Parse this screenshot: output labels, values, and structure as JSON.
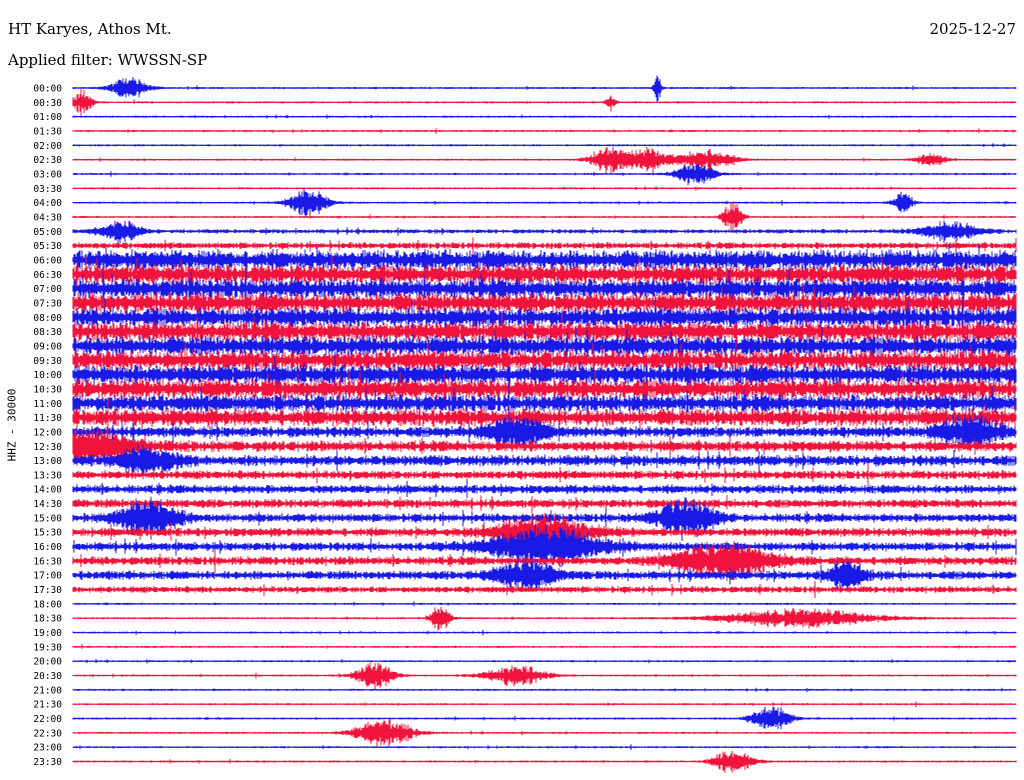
{
  "header": {
    "station": "HT Karyes, Athos Mt.",
    "date": "2025-12-27",
    "filter": "Applied filter: WWSSN-SP"
  },
  "colors": {
    "blue": "#1a1ae6",
    "red": "#f0143c"
  },
  "chart_data": {
    "type": "line",
    "title": "HT Karyes, Athos Mt.",
    "ylabel": "HHZ - 30000",
    "tick_labels": [
      "00:00",
      "00:30",
      "01:00",
      "01:30",
      "02:00",
      "02:30",
      "03:00",
      "03:30",
      "04:00",
      "04:30",
      "05:00",
      "05:30",
      "06:00",
      "06:30",
      "07:00",
      "07:30",
      "08:00",
      "08:30",
      "09:00",
      "09:30",
      "10:00",
      "10:30",
      "11:00",
      "11:30",
      "12:00",
      "12:30",
      "13:00",
      "13:30",
      "14:00",
      "14:30",
      "15:00",
      "15:30",
      "16:00",
      "16:30",
      "17:00",
      "17:30",
      "18:00",
      "18:30",
      "19:00",
      "19:30",
      "20:00",
      "20:30",
      "21:00",
      "21:30",
      "22:00",
      "22:30",
      "23:00",
      "23:30"
    ],
    "noise_level": [
      1,
      1,
      1,
      1,
      1,
      1,
      1,
      1,
      1,
      1,
      2,
      3,
      9,
      9,
      9,
      9,
      9,
      9,
      9,
      9,
      9,
      9,
      8,
      8,
      5,
      5,
      5,
      4,
      4,
      4,
      4,
      4,
      4,
      4,
      4,
      3,
      1,
      1,
      1,
      1,
      1,
      1,
      1,
      1,
      1,
      1,
      1,
      1
    ],
    "events": [
      {
        "row": 0,
        "x": 0.06,
        "a": 8,
        "w": 0.02
      },
      {
        "row": 0,
        "x": 0.62,
        "a": 10,
        "w": 0.004
      },
      {
        "row": 1,
        "x": 0.01,
        "a": 9,
        "w": 0.01
      },
      {
        "row": 1,
        "x": 0.57,
        "a": 6,
        "w": 0.005
      },
      {
        "row": 5,
        "x": 0.57,
        "a": 10,
        "w": 0.02
      },
      {
        "row": 5,
        "x": 0.61,
        "a": 9,
        "w": 0.02
      },
      {
        "row": 5,
        "x": 0.67,
        "a": 8,
        "w": 0.03
      },
      {
        "row": 5,
        "x": 0.91,
        "a": 5,
        "w": 0.015
      },
      {
        "row": 6,
        "x": 0.66,
        "a": 9,
        "w": 0.02
      },
      {
        "row": 8,
        "x": 0.25,
        "a": 11,
        "w": 0.02
      },
      {
        "row": 8,
        "x": 0.88,
        "a": 8,
        "w": 0.01
      },
      {
        "row": 9,
        "x": 0.7,
        "a": 12,
        "w": 0.01
      },
      {
        "row": 10,
        "x": 0.05,
        "a": 8,
        "w": 0.02
      },
      {
        "row": 10,
        "x": 0.93,
        "a": 7,
        "w": 0.03
      },
      {
        "row": 24,
        "x": 0.47,
        "a": 12,
        "w": 0.03
      },
      {
        "row": 24,
        "x": 0.95,
        "a": 12,
        "w": 0.03
      },
      {
        "row": 25,
        "x": 0.01,
        "a": 12,
        "w": 0.05
      },
      {
        "row": 26,
        "x": 0.08,
        "a": 10,
        "w": 0.03
      },
      {
        "row": 30,
        "x": 0.08,
        "a": 14,
        "w": 0.03
      },
      {
        "row": 30,
        "x": 0.65,
        "a": 14,
        "w": 0.03
      },
      {
        "row": 31,
        "x": 0.5,
        "a": 12,
        "w": 0.05
      },
      {
        "row": 32,
        "x": 0.5,
        "a": 14,
        "w": 0.06
      },
      {
        "row": 33,
        "x": 0.69,
        "a": 14,
        "w": 0.05
      },
      {
        "row": 34,
        "x": 0.48,
        "a": 12,
        "w": 0.03
      },
      {
        "row": 34,
        "x": 0.82,
        "a": 10,
        "w": 0.02
      },
      {
        "row": 37,
        "x": 0.39,
        "a": 10,
        "w": 0.01
      },
      {
        "row": 37,
        "x": 0.77,
        "a": 7,
        "w": 0.08
      },
      {
        "row": 41,
        "x": 0.32,
        "a": 10,
        "w": 0.02
      },
      {
        "row": 41,
        "x": 0.47,
        "a": 8,
        "w": 0.03
      },
      {
        "row": 44,
        "x": 0.74,
        "a": 10,
        "w": 0.02
      },
      {
        "row": 45,
        "x": 0.33,
        "a": 10,
        "w": 0.03
      },
      {
        "row": 47,
        "x": 0.7,
        "a": 10,
        "w": 0.02
      }
    ]
  }
}
